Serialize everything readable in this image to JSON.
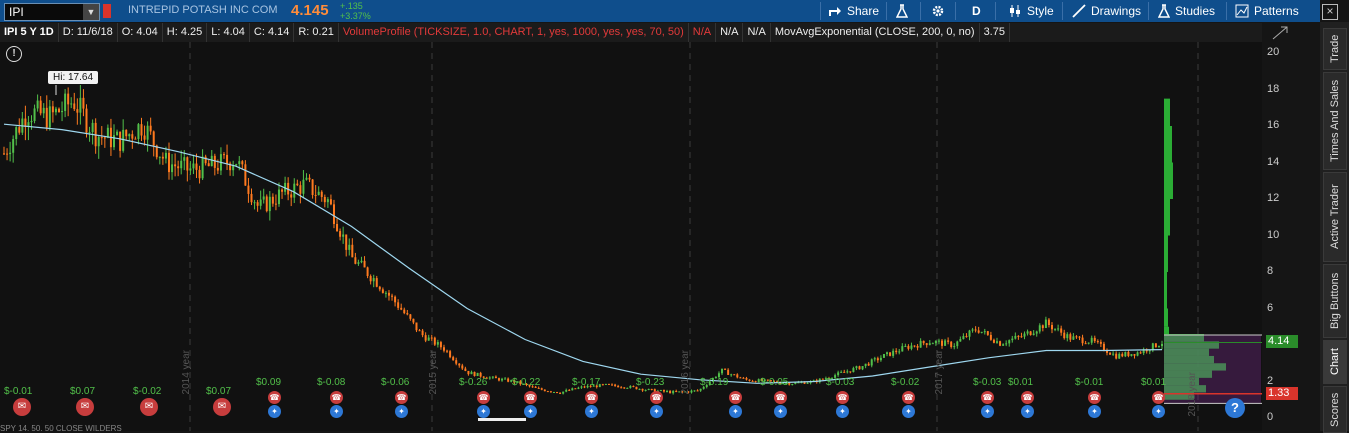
{
  "header": {
    "symbol": "IPI",
    "company": "INTREPID POTASH INC COM",
    "last_price": "4.145",
    "change": "+.135",
    "change_pct": "+3.37%",
    "share_label": "Share",
    "period_label": "D",
    "style_label": "Style",
    "drawings_label": "Drawings",
    "studies_label": "Studies",
    "patterns_label": "Patterns"
  },
  "study_bar": {
    "title": "IPI 5 Y 1D",
    "date": "D: 11/6/18",
    "open": "O: 4.04",
    "high": "H: 4.25",
    "low": "L: 4.04",
    "close": "C: 4.14",
    "range": "R: 0.21",
    "volume_profile": "VolumeProfile (TICKSIZE, 1.0, CHART, 1, yes, 1000, yes, yes, 70, 50)",
    "na1": "N/A",
    "na2": "N/A",
    "na3": "N/A",
    "mov_avg": "MovAvgExponential (CLOSE, 200, 0, no)",
    "mov_avg_value": "3.75"
  },
  "chart_overlay": {
    "hi_label": "Hi: 17.64",
    "current_price_tag": "4.14",
    "poc_tag": "1.33",
    "help_label": "?"
  },
  "y_axis": {
    "labels": [
      "20",
      "18",
      "16",
      "14",
      "12",
      "10",
      "8",
      "6",
      "4",
      "2",
      "0"
    ]
  },
  "dividend_labels": [
    "$-0.01",
    "$0.07",
    "$-0.02",
    "$0.07",
    "$0.09",
    "$-0.08",
    "$-0.06",
    "$-0.26",
    "$-0.22",
    "$-0.17",
    "$-0.23",
    "$-0.19",
    "$-0.05",
    "$-0.03",
    "$-0.02",
    "$-0.03",
    "$0.01",
    "$-0.01",
    "$0.01"
  ],
  "year_labels": [
    "2014 year",
    "2015 year",
    "2016 year",
    "2017 year",
    "2018 year"
  ],
  "side_tabs": [
    "Trade",
    "Times And Sales",
    "Active Trader",
    "Big Buttons",
    "Chart",
    "Scores"
  ],
  "bottom_text": "SPY 14, 50, 50 CLOSE WILDERS",
  "colors": {
    "toolbar": "#0f4e8c",
    "up_candle": "#52c04a",
    "down_candle": "#ff7a1f",
    "moving_average": "#9fd8f0",
    "volume_profile": "#2fbf3a",
    "value_area": "#7a2b8f",
    "price_text": "#ff8c3a"
  },
  "chart_data": {
    "type": "line",
    "title": "IPI 5 Y 1D",
    "ylim": [
      0,
      21
    ],
    "series": [
      {
        "name": "IPI",
        "x": [
          0,
          0.02,
          0.04,
          0.06,
          0.08,
          0.1,
          0.12,
          0.14,
          0.16,
          0.18,
          0.2,
          0.22,
          0.24,
          0.26,
          0.28,
          0.3,
          0.32,
          0.34,
          0.36,
          0.38,
          0.4,
          0.42,
          0.44,
          0.46,
          0.48,
          0.5,
          0.52,
          0.54,
          0.56,
          0.58,
          0.6,
          0.62,
          0.64,
          0.66,
          0.68,
          0.7,
          0.72,
          0.74,
          0.76,
          0.78,
          0.8,
          0.82,
          0.84,
          0.86,
          0.88,
          0.9,
          0.92,
          0.94,
          0.96,
          0.98,
          1.0
        ],
        "values": [
          14.5,
          16.8,
          16.5,
          17.4,
          15.5,
          15.2,
          16.1,
          14.0,
          13.6,
          13.8,
          14.2,
          11.5,
          12.3,
          12.8,
          11.9,
          8.8,
          7.6,
          6.2,
          4.6,
          3.8,
          2.5,
          2.2,
          2.0,
          1.6,
          1.4,
          1.7,
          1.8,
          1.7,
          1.5,
          1.4,
          1.5,
          2.6,
          2.1,
          2.0,
          1.9,
          2.0,
          2.4,
          2.8,
          3.4,
          3.9,
          4.2,
          4.0,
          4.9,
          4.1,
          4.5,
          5.2,
          4.4,
          4.2,
          3.4,
          3.6,
          4.14
        ]
      },
      {
        "name": "MovAvgExponential",
        "x": [
          0,
          0.05,
          0.1,
          0.15,
          0.2,
          0.25,
          0.3,
          0.35,
          0.4,
          0.45,
          0.5,
          0.55,
          0.6,
          0.65,
          0.7,
          0.75,
          0.8,
          0.85,
          0.9,
          0.95,
          1.0
        ],
        "values": [
          16.1,
          15.8,
          15.3,
          14.6,
          13.8,
          12.4,
          10.5,
          8.2,
          6.0,
          4.3,
          3.1,
          2.4,
          2.1,
          1.9,
          2.0,
          2.3,
          2.8,
          3.3,
          3.7,
          3.7,
          3.75
        ]
      }
    ]
  }
}
